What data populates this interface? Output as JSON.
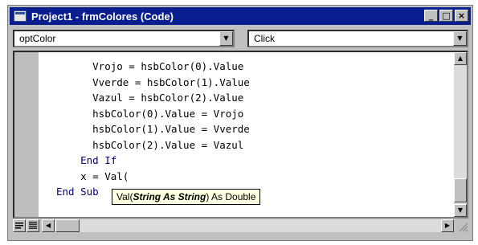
{
  "window": {
    "title": "Project1 - frmColores (Code)"
  },
  "title_buttons": {
    "minimize": "_",
    "maximize": "□",
    "close": "×"
  },
  "object_dropdown": {
    "value": "optColor"
  },
  "procedure_dropdown": {
    "value": "Click"
  },
  "code_lines": [
    {
      "indent": "      ",
      "keyword": "",
      "text": "Vrojo = hsbColor(0).Value"
    },
    {
      "indent": "      ",
      "keyword": "",
      "text": "Vverde = hsbColor(1).Value"
    },
    {
      "indent": "      ",
      "keyword": "",
      "text": "Vazul = hsbColor(2).Value"
    },
    {
      "indent": "      ",
      "keyword": "",
      "text": "hsbColor(0).Value = Vrojo"
    },
    {
      "indent": "      ",
      "keyword": "",
      "text": "hsbColor(1).Value = Vverde"
    },
    {
      "indent": "      ",
      "keyword": "",
      "text": "hsbColor(2).Value = Vazul"
    },
    {
      "indent": "    ",
      "keyword": "End If",
      "text": ""
    },
    {
      "indent": "    ",
      "keyword": "",
      "text": "x = Val("
    },
    {
      "indent": "",
      "keyword": "End Sub",
      "text": ""
    }
  ],
  "tooltip": {
    "prefix": "Val(",
    "param": "String As String",
    "suffix": ") As Double"
  },
  "icons": {
    "window": "code-window-icon",
    "dropdown": "chevron-down-icon",
    "scroll_up": "arrow-up-icon",
    "scroll_down": "arrow-down-icon",
    "scroll_left": "arrow-left-icon",
    "scroll_right": "arrow-right-icon",
    "procedure_view": "procedure-view-icon",
    "module_view": "full-module-view-icon"
  },
  "colors": {
    "titlebar": "#0a1f8f",
    "keyword": "#00007f",
    "tooltip_bg": "#ffffe1"
  }
}
